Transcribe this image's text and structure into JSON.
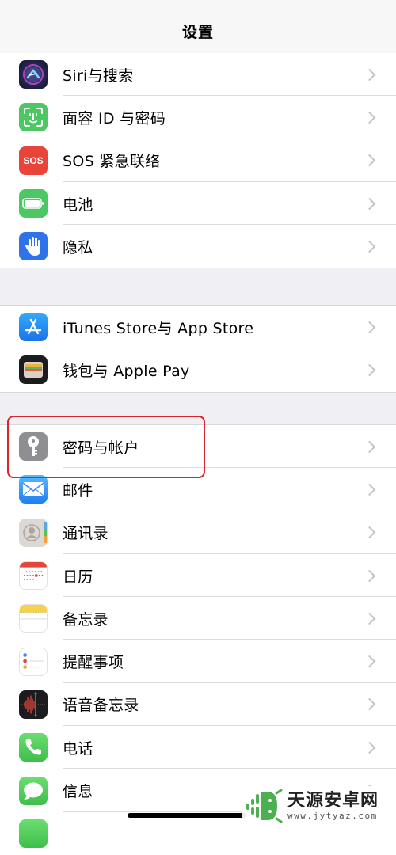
{
  "header": {
    "title": "设置"
  },
  "sections": [
    {
      "items": [
        {
          "label": "Siri与搜索",
          "icon": "siri-icon",
          "color": "#2b2d5a"
        },
        {
          "label": "面容 ID 与密码",
          "icon": "face-id-icon",
          "color": "#4cc764"
        },
        {
          "label": "SOS 紧急联络",
          "icon": "sos-icon",
          "color": "#e9443a",
          "icon_text": "SOS"
        },
        {
          "label": "电池",
          "icon": "battery-icon",
          "color": "#4cc764"
        },
        {
          "label": "隐私",
          "icon": "hand-privacy-icon",
          "color": "#2e74e8"
        }
      ]
    },
    {
      "items": [
        {
          "label": "iTunes Store与 App Store",
          "icon": "app-store-icon",
          "color": "#1e8ff5"
        },
        {
          "label": "钱包与 Apple Pay",
          "icon": "wallet-icon",
          "color": "#1c1c1e"
        }
      ]
    },
    {
      "items": [
        {
          "label": "密码与帐户",
          "icon": "key-icon",
          "color": "#8e8e93",
          "highlighted": true
        },
        {
          "label": "邮件",
          "icon": "mail-icon",
          "color": "#2f8ff2"
        },
        {
          "label": "通讯录",
          "icon": "contacts-icon",
          "color": "#d9d6d2"
        },
        {
          "label": "日历",
          "icon": "calendar-icon",
          "color": "#ffffff"
        },
        {
          "label": "备忘录",
          "icon": "notes-icon",
          "color": "#ffffff"
        },
        {
          "label": "提醒事项",
          "icon": "reminders-icon",
          "color": "#ffffff"
        },
        {
          "label": "语音备忘录",
          "icon": "voice-memos-icon",
          "color": "#1c1c1e"
        },
        {
          "label": "电话",
          "icon": "phone-icon",
          "color": "#4cc764"
        },
        {
          "label": "信息",
          "icon": "messages-icon",
          "color": "#4cc764"
        },
        {
          "label": "",
          "icon": "facetime-icon",
          "color": "#4cc764"
        }
      ]
    }
  ],
  "watermark": {
    "name": "天源安卓网",
    "url": "www.jytyaz.com",
    "color": "#4caf50"
  },
  "highlight_color": "#d9232d"
}
